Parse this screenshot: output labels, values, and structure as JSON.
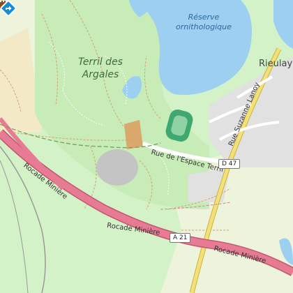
{
  "labels": {
    "nature_reserve": "Réserve\nornithologique",
    "terril": "Terril des\nArgales",
    "town": "Rieulay",
    "rue_espace_terril": "Rue de l'Espace Terril",
    "rue_suzanne_lanoy": "Rue Suzanne Lanoy",
    "rocade_1": "Rocade Minière",
    "rocade_2": "Rocade Minière",
    "rocade_3": "Rocade Minière",
    "route_d47": "D 47",
    "route_a21": "A 21"
  },
  "icons": {
    "location_marker": "diamond-pin-icon",
    "castle": "castle-icon"
  },
  "colors": {
    "land": "#d3f2c8",
    "park": "#c8ecb8",
    "water": "#9ccff0",
    "motorway": "#e77b94",
    "road_primary": "#f4e07a",
    "residential": "#e1e1e1",
    "pitch": "#3fa871",
    "marker": "#1a8bd6"
  }
}
